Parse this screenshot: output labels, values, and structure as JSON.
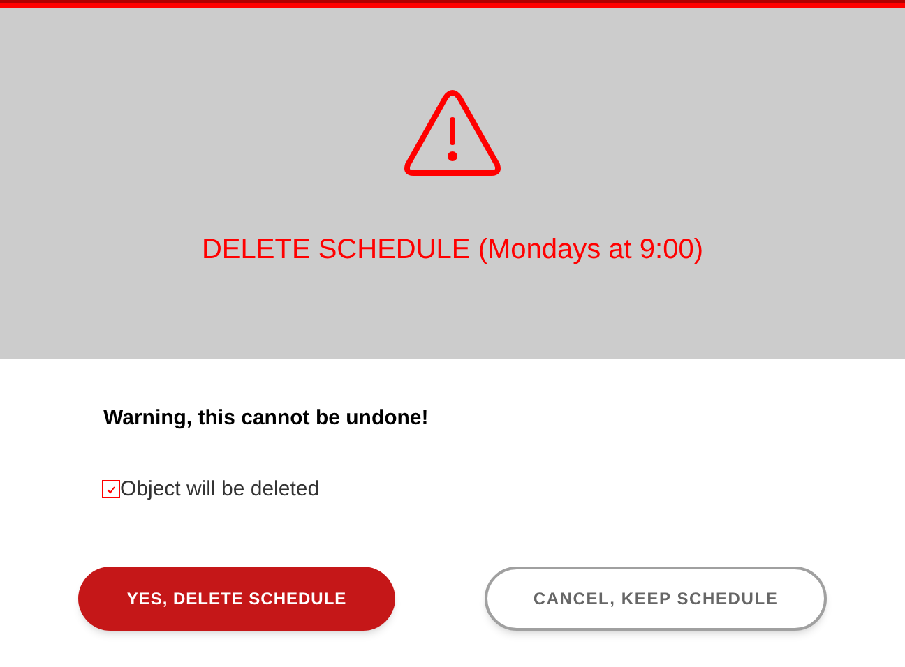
{
  "dialog": {
    "title": "DELETE SCHEDULE (Mondays at 9:00)",
    "warning": "Warning, this cannot be undone!",
    "checkbox": {
      "label": "Object will be deleted",
      "checked": true
    },
    "buttons": [
      {
        "label": "YES, DELETE SCHEDULE",
        "kind": "danger"
      },
      {
        "label": "CANCEL, KEEP SCHEDULE",
        "kind": "secondary"
      }
    ]
  }
}
